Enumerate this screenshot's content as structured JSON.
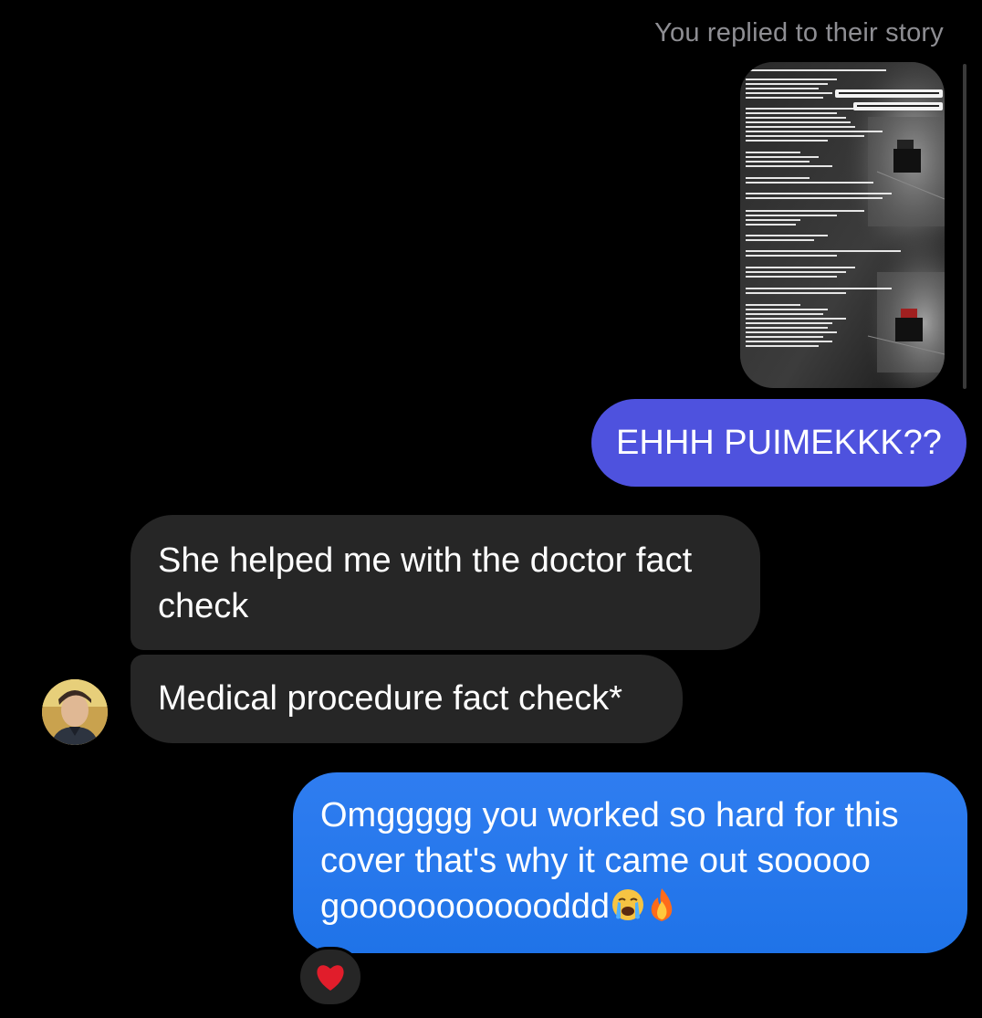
{
  "story_reply": {
    "caption": "You replied to their story",
    "thumbnail_badges": [
      "LOVE EVERY SINGLE PART IN THE VID!",
      "THANKS FOR THE GREAT WORK"
    ]
  },
  "messages": {
    "sent_1": "EHHH PUIMEKKK??",
    "received_1": "She helped me with the doctor fact check",
    "received_2": "Medical procedure fact check*",
    "sent_2": "Omggggg you worked so hard for this cover that's why it came out sooooo goooooooooooddd"
  },
  "reaction": {
    "icon": "red-heart-icon"
  },
  "icons": {
    "emoji_1": "crying-face-icon",
    "emoji_2": "fire-icon"
  },
  "colors": {
    "background": "#000000",
    "received_bubble": "#262626",
    "sent_purple": "#4e52de",
    "sent_blue": "#2f7df0",
    "caption": "#8e8e93"
  }
}
